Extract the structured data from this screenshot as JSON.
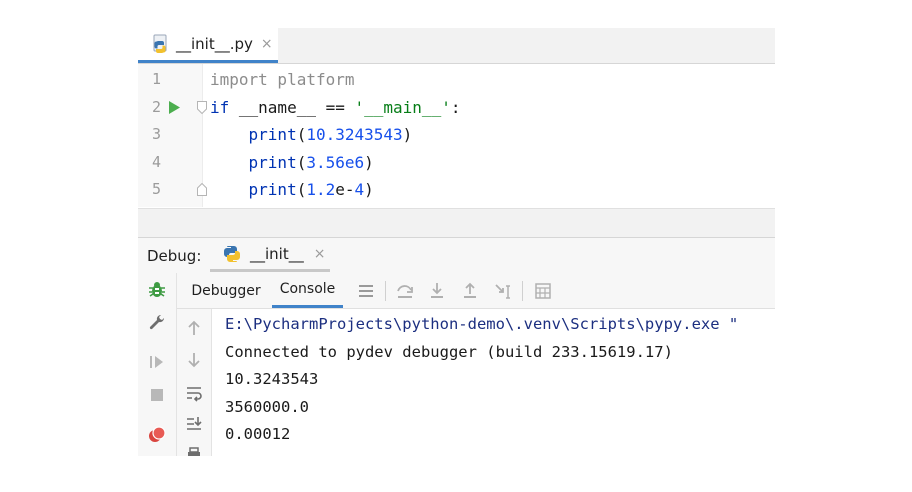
{
  "editor_tab": {
    "file_name": "__init__.py",
    "close_glyph": "×",
    "icon": "python-file-icon"
  },
  "code": {
    "lines": [
      {
        "number": "1",
        "parts": [
          {
            "t": "import platform",
            "c": "dim"
          }
        ]
      },
      {
        "number": "2",
        "parts": [
          {
            "t": "if",
            "c": "kw"
          },
          {
            "t": " __name__ == ",
            "c": "plain"
          },
          {
            "t": "'__main__'",
            "c": "str"
          },
          {
            "t": ":",
            "c": "plain"
          }
        ]
      },
      {
        "number": "3",
        "parts": [
          {
            "t": "    ",
            "c": "plain"
          },
          {
            "t": "print",
            "c": "fn"
          },
          {
            "t": "(",
            "c": "plain"
          },
          {
            "t": "10.3243543",
            "c": "num"
          },
          {
            "t": ")",
            "c": "plain"
          }
        ]
      },
      {
        "number": "4",
        "parts": [
          {
            "t": "    ",
            "c": "plain"
          },
          {
            "t": "print",
            "c": "fn"
          },
          {
            "t": "(",
            "c": "plain"
          },
          {
            "t": "3.56e6",
            "c": "num"
          },
          {
            "t": ")",
            "c": "plain"
          }
        ]
      },
      {
        "number": "5",
        "parts": [
          {
            "t": "    ",
            "c": "plain"
          },
          {
            "t": "print",
            "c": "fn"
          },
          {
            "t": "(",
            "c": "plain"
          },
          {
            "t": "1.2",
            "c": "num"
          },
          {
            "t": "e-",
            "c": "plain"
          },
          {
            "t": "4",
            "c": "num"
          },
          {
            "t": ")",
            "c": "plain"
          }
        ]
      }
    ]
  },
  "debug": {
    "title": "Debug:",
    "session_tab": {
      "label": "__init__",
      "close_glyph": "×"
    },
    "tabs": [
      {
        "label": "Debugger",
        "active": false
      },
      {
        "label": "Console",
        "active": true
      }
    ],
    "toolbar_icons": [
      "menu-icon",
      "step-over-icon",
      "step-into-icon",
      "step-out-icon",
      "run-to-cursor-icon",
      "evaluate-icon"
    ],
    "left_toolbar_icons": [
      "bug-icon",
      "wrench-icon",
      "resume-icon",
      "stop-icon",
      "breakpoints-icon"
    ],
    "console_toolbar_icons": [
      "scroll-up-icon",
      "scroll-down-icon",
      "soft-wrap-icon",
      "scroll-to-end-icon",
      "print-icon"
    ]
  },
  "console": {
    "lines": [
      {
        "text": "E:\\PycharmProjects\\python-demo\\.venv\\Scripts\\pypy.exe \"",
        "kind": "cmd"
      },
      {
        "text": "Connected to pydev debugger (build 233.15619.17)",
        "kind": "out"
      },
      {
        "text": "10.3243543",
        "kind": "out"
      },
      {
        "text": "3560000.0",
        "kind": "out"
      },
      {
        "text": "0.00012",
        "kind": "out"
      }
    ]
  },
  "colors": {
    "accent": "#4083c9",
    "keyword": "#0033b3",
    "number": "#1750eb",
    "string": "#067d17",
    "run": "#4cae4f",
    "debug_green": "#3e9b43",
    "stop_red": "#d9453f"
  }
}
